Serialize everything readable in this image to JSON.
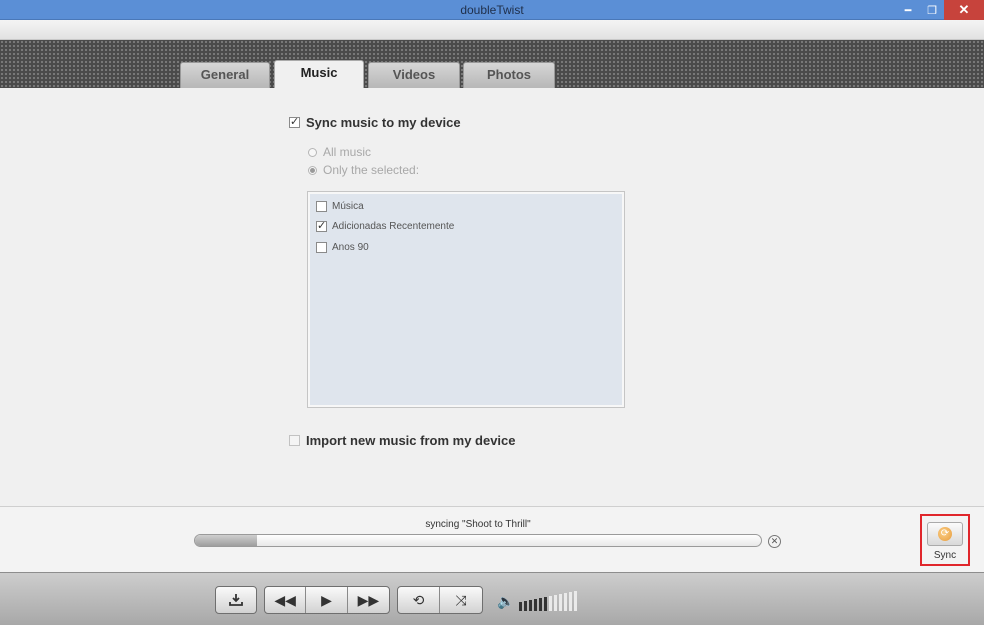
{
  "window": {
    "title": "doubleTwist"
  },
  "tabs": [
    {
      "label": "General"
    },
    {
      "label": "Music"
    },
    {
      "label": "Videos"
    },
    {
      "label": "Photos"
    }
  ],
  "music": {
    "sync_label": "Sync music to my device",
    "sync_checked": true,
    "option_all": "All music",
    "option_selected": "Only the selected:",
    "selected_option": "Only the selected:",
    "playlists": [
      {
        "label": "Música",
        "checked": false
      },
      {
        "label": "Adicionadas Recentemente",
        "checked": true
      },
      {
        "label": "Anos 90",
        "checked": false
      }
    ],
    "import_label": "Import new music from my device",
    "import_checked": false
  },
  "sync_status": {
    "text": "syncing \"Shoot to Thrill\"",
    "progress": 0.11,
    "sync_button_label": "Sync"
  },
  "player": {
    "volume_level": 0.45
  },
  "colors": {
    "titlebar": "#5b8fd6",
    "close": "#c7433c",
    "highlight": "#e0262b"
  }
}
